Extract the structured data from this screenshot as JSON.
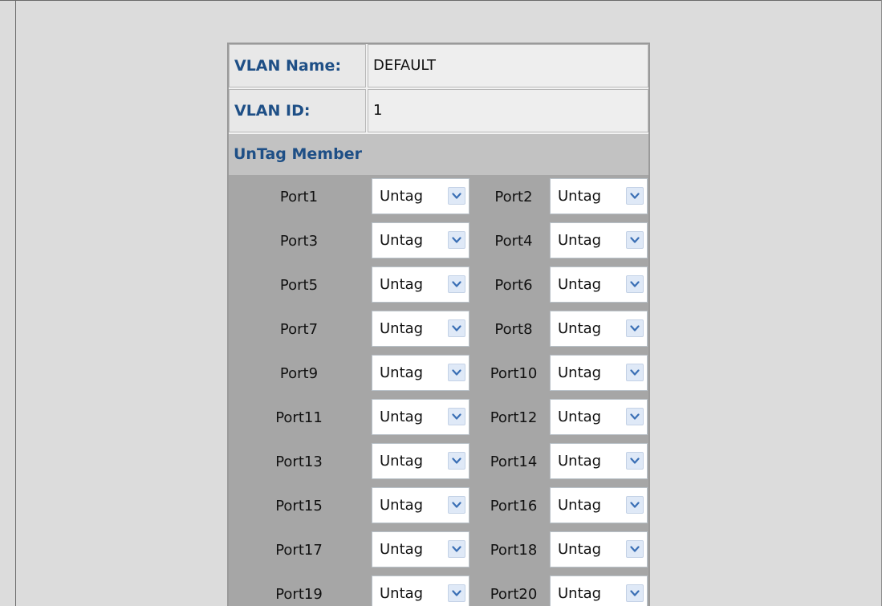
{
  "vlan": {
    "name_label": "VLAN Name:",
    "name_value": "DEFAULT",
    "id_label": "VLAN ID:",
    "id_value": "1"
  },
  "section_title": "UnTag Member",
  "ports": [
    {
      "left": {
        "name": "Port1",
        "value": "Untag"
      },
      "right": {
        "name": "Port2",
        "value": "Untag"
      }
    },
    {
      "left": {
        "name": "Port3",
        "value": "Untag"
      },
      "right": {
        "name": "Port4",
        "value": "Untag"
      }
    },
    {
      "left": {
        "name": "Port5",
        "value": "Untag"
      },
      "right": {
        "name": "Port6",
        "value": "Untag"
      }
    },
    {
      "left": {
        "name": "Port7",
        "value": "Untag"
      },
      "right": {
        "name": "Port8",
        "value": "Untag"
      }
    },
    {
      "left": {
        "name": "Port9",
        "value": "Untag"
      },
      "right": {
        "name": "Port10",
        "value": "Untag"
      }
    },
    {
      "left": {
        "name": "Port11",
        "value": "Untag"
      },
      "right": {
        "name": "Port12",
        "value": "Untag"
      }
    },
    {
      "left": {
        "name": "Port13",
        "value": "Untag"
      },
      "right": {
        "name": "Port14",
        "value": "Untag"
      }
    },
    {
      "left": {
        "name": "Port15",
        "value": "Untag"
      },
      "right": {
        "name": "Port16",
        "value": "Untag"
      }
    },
    {
      "left": {
        "name": "Port17",
        "value": "Untag"
      },
      "right": {
        "name": "Port18",
        "value": "Untag"
      }
    },
    {
      "left": {
        "name": "Port19",
        "value": "Untag"
      },
      "right": {
        "name": "Port20",
        "value": "Untag"
      }
    }
  ],
  "colors": {
    "label_blue": "#1e4f86",
    "port_area": "#a6a6a6",
    "section_bar": "#c2c2c2"
  },
  "icons": {
    "dropdown": "chevron-down-icon"
  }
}
